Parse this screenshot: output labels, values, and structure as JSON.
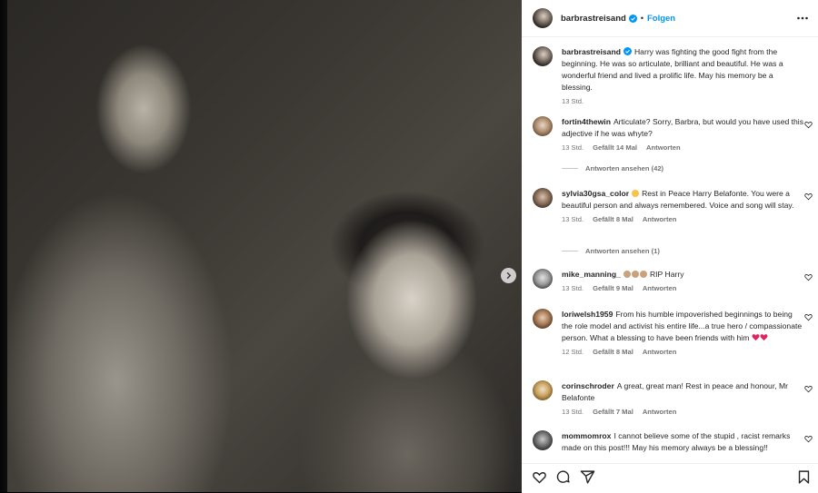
{
  "post": {
    "username": "barbrastreisand",
    "follow_label": "Folgen",
    "separator": "•"
  },
  "caption": {
    "username": "barbrastreisand",
    "text": "Harry was fighting the good fight from the beginning. He was so articulate, brilliant and beautiful. He was a wonderful friend and lived a prolific life. May his memory be a blessing.",
    "time": "13 Std."
  },
  "comments": [
    {
      "username": "fortin4thewin",
      "text": "Articulate? Sorry, Barbra, but would you have used this adjective if he was whyte?",
      "time": "13 Std.",
      "likes": "Gefällt 14 Mal",
      "reply_label": "Antworten",
      "view_replies": "Antworten ansehen (42)"
    },
    {
      "username": "sylvia30gsa_color",
      "text": "Rest in Peace Harry Belafonte. You were a beautiful person and always remembered. Voice and song will stay.",
      "time": "13 Std.",
      "likes": "Gefällt 8 Mal",
      "reply_label": "Antworten",
      "view_replies": "Antworten ansehen (1)"
    },
    {
      "username": "mike_manning_",
      "text": "RIP Harry",
      "time": "13 Std.",
      "likes": "Gefällt 9 Mal",
      "reply_label": "Antworten"
    },
    {
      "username": "loriwelsh1959",
      "text": "From his humble impoverished beginnings to being the role model and activist his entire life...a true hero / compassionate person. What a blessing to have been friends with him",
      "time": "12 Std.",
      "likes": "Gefällt 8 Mal",
      "reply_label": "Antworten"
    },
    {
      "username": "corinschroder",
      "text": "A great, great man! Rest in peace and honour, Mr Belafonte",
      "time": "13 Std.",
      "likes": "Gefällt 7 Mal",
      "reply_label": "Antworten"
    },
    {
      "username": "mommomrox",
      "text": "I cannot believe some of the stupid , racist remarks made on this post!!! May his memory always be a blessing!!"
    }
  ],
  "icons": {
    "verified": "verified-badge-icon",
    "more": "more-options-icon",
    "like": "heart-icon",
    "comment": "comment-icon",
    "share": "share-icon",
    "save": "bookmark-icon",
    "next": "chevron-right-icon"
  },
  "colors": {
    "accent": "#0095f6",
    "text": "#262626",
    "secondary": "#737373",
    "red": "#ed4956"
  }
}
